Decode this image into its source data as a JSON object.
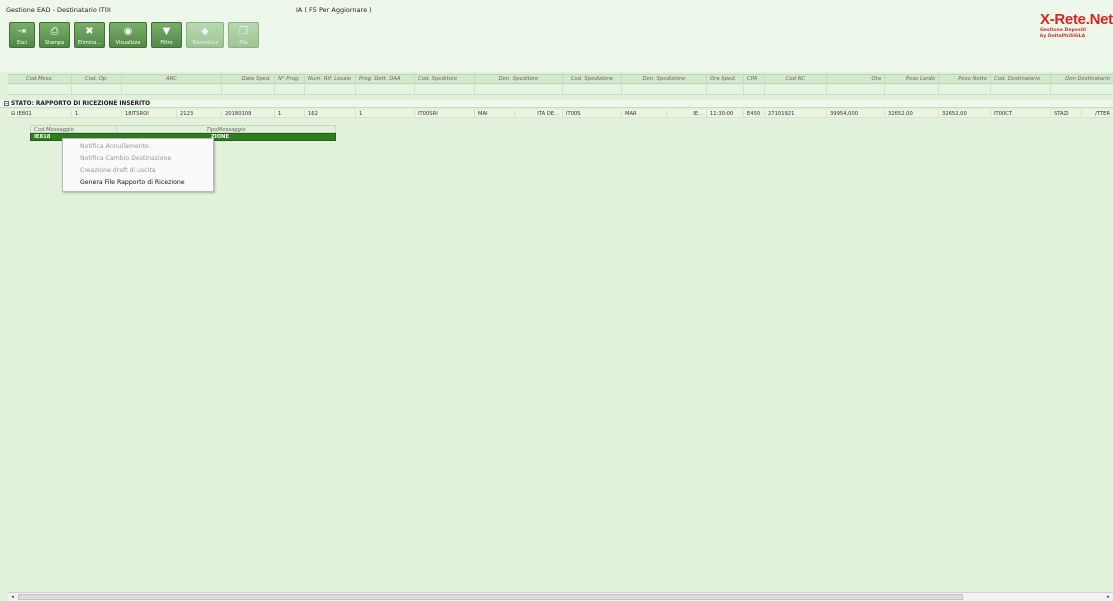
{
  "app": {
    "title": "Gestione EAD - Destinatario IT0I",
    "hint": "IA ( F5 Per Aggiornare )"
  },
  "toolbar": {
    "buttons": [
      {
        "label": "Esci",
        "icon": "exit-icon",
        "glyph": "⇥"
      },
      {
        "label": "Stampa",
        "icon": "printer-icon",
        "glyph": "⎙"
      },
      {
        "label": "Elimina...",
        "icon": "trash-icon",
        "glyph": "✖"
      },
      {
        "label": "Visualizza",
        "icon": "view-icon",
        "glyph": "◉"
      },
      {
        "label": "Filtro",
        "icon": "filter-icon",
        "glyph": "▼"
      },
      {
        "label": "Telematico",
        "icon": "telematic-icon",
        "glyph": "◆"
      },
      {
        "label": "File",
        "icon": "file-icon",
        "glyph": "❐"
      }
    ]
  },
  "logo": {
    "main": "X-Rete.Net",
    "sub1": "Gestione Depositi",
    "sub2": "by DeltaPhiSIGLA"
  },
  "grid": {
    "headers": [
      "Cod.Mess.",
      "Cod. Op.",
      "ARC",
      "Data Sped.",
      "N° Prog.",
      "Num. Rif. Locale",
      "Prog. Dett. DAA",
      "Cod. Speditore",
      "Den. Speditore",
      "Cod. Spedizione",
      "Den. Spedizione",
      "Ora Sped.",
      "CPA",
      "Cod NC",
      "Qta",
      "Peso Lordo",
      "Peso Netto",
      "Cod. Destinatario",
      "Den Destinatario"
    ],
    "group_label": "STATO: RAPPORTO DI RICEZIONE INSERITO",
    "row": [
      "IE801",
      "1",
      "18ITSROI",
      "2123",
      "20180109",
      "1",
      "162",
      "1",
      "IT00SRI",
      "MAI",
      "ITA DE...",
      "IT00S",
      "MAR",
      "IE...",
      "11:30:00",
      "E450",
      "27101921",
      "39954,000",
      "32652,00",
      "32652,00",
      "IT00CT",
      "STAZI",
      "/TTER"
    ]
  },
  "detail": {
    "headers": [
      "Cod.Messaggio",
      "TipoMessaggio"
    ],
    "row": [
      "IE818",
      "ZIONE"
    ]
  },
  "context_menu": {
    "items": [
      {
        "label": "Notifica Annullamento",
        "enabled": false
      },
      {
        "label": "Notifica Cambio Destinazione",
        "enabled": false
      },
      {
        "label": "Creazione draft di uscita",
        "enabled": false
      },
      {
        "label": "Genera File Rapporto di Ricezione",
        "enabled": true
      }
    ]
  },
  "scroll": {
    "left_glyph": "◂",
    "right_glyph": "▸"
  }
}
